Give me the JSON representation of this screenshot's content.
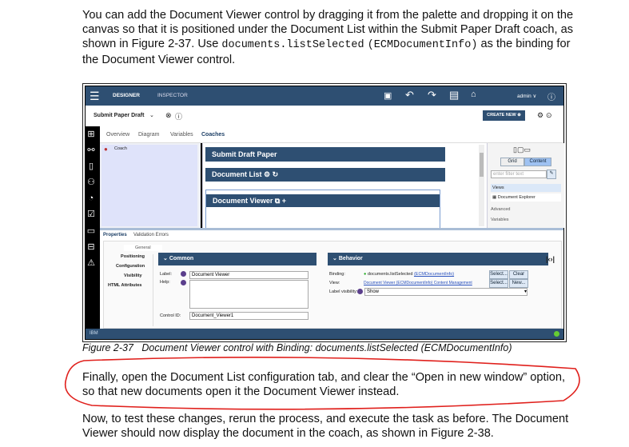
{
  "intro": {
    "p1": "You can add the Document Viewer control by dragging it from the palette and dropping it on the canvas so that it is positioned under the Document List within the Submit Paper Draft coach, as shown in Figure 2-37. Use ",
    "code1": "documents.listSelected",
    "mid": " ",
    "code2": "(ECMDocumentInfo)",
    "p2": " as the binding for the Document Viewer control."
  },
  "app": {
    "topbar": {
      "designer": "DESIGNER",
      "inspector": "INSPECTOR",
      "user": "admin ∨",
      "info": "ⓘ"
    },
    "titlebar": {
      "title": "Submit Paper Draft",
      "chevron": "⌄",
      "create_new": "CREATE NEW ⊕"
    },
    "tabs": [
      "Overview",
      "Diagram",
      "Variables",
      "Coaches"
    ],
    "coach_item": "Coach",
    "canvas": {
      "title": "Submit Draft Paper",
      "doc_list": "Document List",
      "doc_viewer": "Document Viewer"
    },
    "palette": {
      "grid": "Grid",
      "content": "Content",
      "filter_placeholder": "enter filter text",
      "views": "Views",
      "item": "Document Explorer",
      "advanced": "Advanced",
      "variables": "Variables"
    },
    "props": {
      "tabs": [
        "Properties",
        "Validation Errors"
      ],
      "nav": [
        "General",
        "Positioning",
        "Configuration",
        "Visibility",
        "HTML Attributes"
      ],
      "common": {
        "header": "Common",
        "label_lbl": "Label:",
        "label_val": "Document Viewer",
        "help_lbl": "Help:",
        "control_id_lbl": "Control ID:",
        "control_id_val": "Document_Viewer1"
      },
      "behavior": {
        "header": "Behavior",
        "binding_lbl": "Binding:",
        "binding_val": "documents.listSelected",
        "binding_type": "(ECMDocumentInfo)",
        "view_lbl": "View:",
        "view_val": "Document Viewer (ECMDocumentInfo) Content Management",
        "label_vis_lbl": "Label visibility:",
        "label_vis_val": "Show",
        "select": "Select...",
        "clear": "Clear",
        "new": "New..."
      }
    },
    "footer": "IBM"
  },
  "caption": "Figure 2-37   Document Viewer control with Binding: documents.listSelected (ECMDocumentInfo)",
  "para2": "Finally, open the Document List configuration tab, and clear the “Open in new window” option, so that new documents open it the Document Viewer instead.",
  "para3": "Now, to test these changes, rerun the process, and execute the task as before. The Document Viewer should now display the document in the coach, as shown in Figure 2-38.",
  "colors": {
    "header": "#2e4f72",
    "annotation": "#e0201c"
  }
}
